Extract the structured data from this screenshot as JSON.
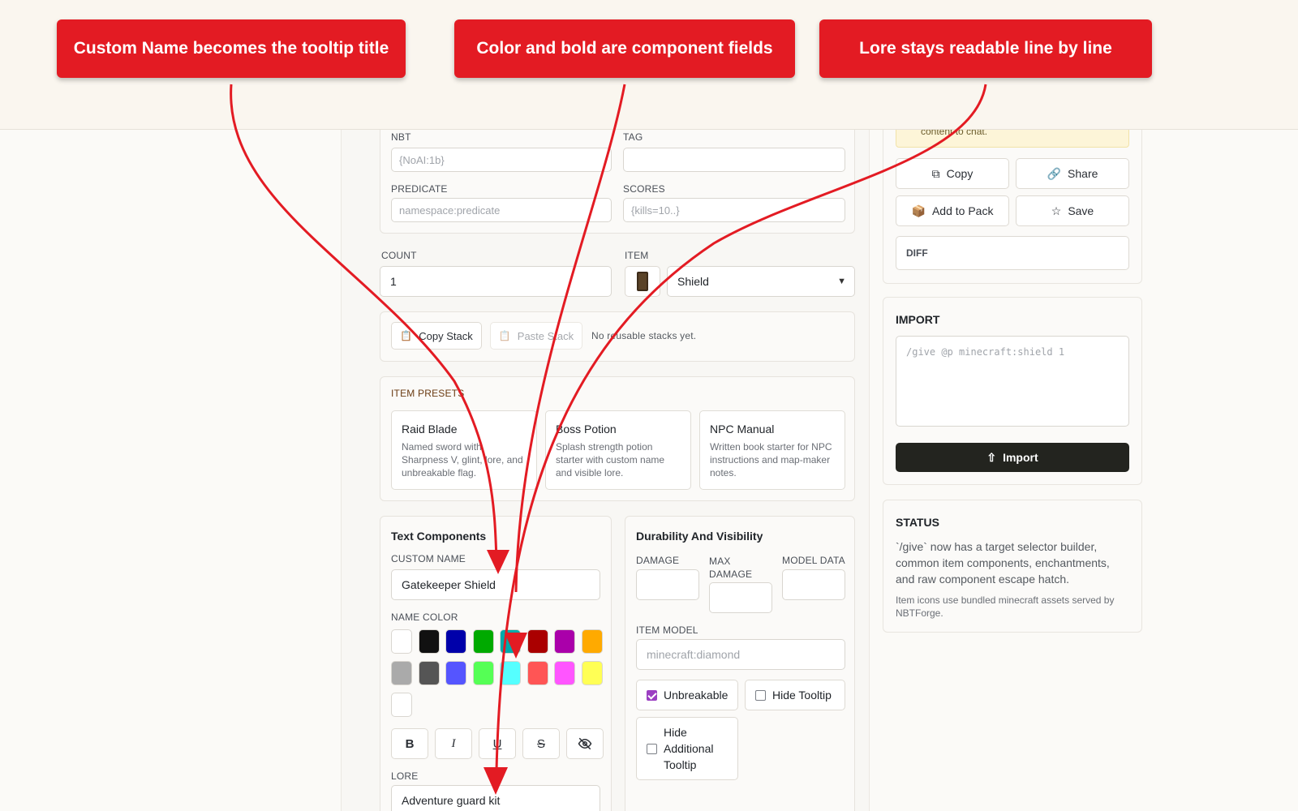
{
  "callouts": [
    "Custom Name becomes the tooltip title",
    "Color and bold are component fields",
    "Lore stays readable line by line"
  ],
  "selector": {
    "nbt_label": "NBT",
    "nbt_placeholder": "{NoAI:1b}",
    "tag_label": "TAG",
    "tag_placeholder": "",
    "predicate_label": "PREDICATE",
    "predicate_placeholder": "namespace:predicate",
    "scores_label": "SCORES",
    "scores_placeholder": "{kills=10..}"
  },
  "stack": {
    "count_label": "COUNT",
    "count_value": "1",
    "item_label": "ITEM",
    "item_value": "Shield"
  },
  "clipboard": {
    "copy_label": "Copy Stack",
    "paste_label": "Paste Stack",
    "status": "No reusable stacks yet."
  },
  "presets": {
    "title": "ITEM PRESETS",
    "items": [
      {
        "name": "Raid Blade",
        "desc": "Named sword with Sharpness V, glint, lore, and unbreakable flag."
      },
      {
        "name": "Boss Potion",
        "desc": "Splash strength potion starter with custom name and visible lore."
      },
      {
        "name": "NPC Manual",
        "desc": "Written book starter for NPC instructions and map-maker notes."
      }
    ]
  },
  "text_components": {
    "title": "Text Components",
    "custom_name_label": "CUSTOM NAME",
    "custom_name_value": "Gatekeeper Shield",
    "name_color_label": "NAME COLOR",
    "colors": [
      "#ffffff",
      "#111111",
      "#0000aa",
      "#00aa00",
      "#00aaaa",
      "#aa0000",
      "#aa00aa",
      "#ffaa00",
      "#aaaaaa",
      "#555555",
      "#5555ff",
      "#55ff55",
      "#55ffff",
      "#ff5555",
      "#ff55ff",
      "#ffff55",
      "#ffffff"
    ],
    "format_buttons": [
      "B",
      "I",
      "U",
      "S",
      "eye-off"
    ],
    "lore_label": "LORE",
    "lore_value": "Adventure guard kit"
  },
  "durability": {
    "title": "Durability And Visibility",
    "damage_label": "DAMAGE",
    "max_damage_label": "MAX DAMAGE",
    "model_data_label": "MODEL DATA",
    "item_model_label": "ITEM MODEL",
    "item_model_placeholder": "minecraft:diamond",
    "unbreakable_label": "Unbreakable",
    "unbreakable_checked": true,
    "hide_tooltip_label": "Hide Tooltip",
    "hide_additional_label": "Hide Additional Tooltip"
  },
  "actions": {
    "notice_text": "content to chat.",
    "copy_label": "Copy",
    "share_label": "Share",
    "add_to_pack_label": "Add to Pack",
    "save_label": "Save",
    "diff_label": "DIFF"
  },
  "import": {
    "title": "IMPORT",
    "placeholder": "/give @p minecraft:shield 1",
    "button_label": "Import"
  },
  "status": {
    "title": "STATUS",
    "text": "`/give` now has a target selector builder, common item components, enchantments, and raw component escape hatch.",
    "note": "Item icons use bundled minecraft assets served by NBTForge."
  },
  "colors": {
    "accent": "#e31b23",
    "primary_button": "#23241f",
    "checkbox": "#9b3fc2"
  }
}
